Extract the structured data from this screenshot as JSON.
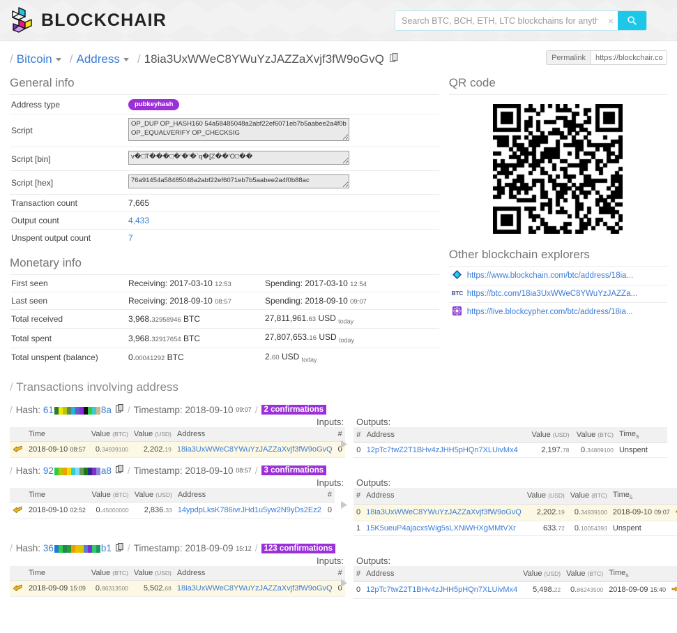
{
  "brand": {
    "name": "BLOCKCHAIR",
    "logo_colors": [
      "#23c3e8",
      "#e6197f",
      "#f5e019",
      "#7b33c9"
    ]
  },
  "search": {
    "placeholder": "Search BTC, BCH, ETH, LTC blockchains for anything...",
    "value": "",
    "clear_label": "×",
    "button_icon": "search-icon",
    "accent": "#1ec7e8"
  },
  "breadcrumb": {
    "sep": "/",
    "chain": "Bitcoin",
    "kind": "Address",
    "address": "18ia3UxWWeC8YWuYzJAZZaXvjf3fW9oGvQ",
    "copy_icon": "copy-icon"
  },
  "permalink": {
    "label": "Permalink",
    "value": "https://blockchair.co"
  },
  "general": {
    "title": "General info",
    "rows": [
      {
        "key": "Address type",
        "badge": "pubkeyhash"
      },
      {
        "key": "Script",
        "value": "OP_DUP OP_HASH160 54a58485048a2abf22ef6071eb7b5aabee2a4f0b OP_EQUALVERIFY OP_CHECKSIG"
      },
      {
        "key": "Script [bin]",
        "value": "v�□T���□�'�'�`q�[Z��'O□��"
      },
      {
        "key": "Script [hex]",
        "value": "76a91454a58485048a2abf22ef6071eb7b5aabee2a4f0b88ac"
      },
      {
        "key": "Transaction count",
        "value": "7,665"
      },
      {
        "key": "Output count",
        "value": "4,433"
      },
      {
        "key": "Unspent output count",
        "value": "7"
      }
    ]
  },
  "monetary": {
    "title": "Monetary info",
    "rows": [
      {
        "key": "First seen",
        "c1_main": "Receiving: 2017-03-10",
        "c1_sub": "12:53",
        "c2_main": "Spending: 2017-03-10",
        "c2_sub": "12:54"
      },
      {
        "key": "Last seen",
        "c1_main": "Receiving: 2018-09-10",
        "c1_sub": "08:57",
        "c2_main": "Spending: 2018-09-10",
        "c2_sub": "09:07"
      },
      {
        "key": "Total received",
        "c1_int": "3,968.",
        "c1_dec": "32958946",
        "c1_unit": "BTC",
        "c2_int": "27,811,961.",
        "c2_dec": "63",
        "c2_unit": "USD",
        "c2_when": "today"
      },
      {
        "key": "Total spent",
        "c1_int": "3,968.",
        "c1_dec": "32917654",
        "c1_unit": "BTC",
        "c2_int": "27,807,653.",
        "c2_dec": "16",
        "c2_unit": "USD",
        "c2_when": "today"
      },
      {
        "key": "Total unspent (balance)",
        "c1_int": "0.",
        "c1_dec": "00041292",
        "c1_unit": "BTC",
        "c2_int": "2.",
        "c2_dec": "60",
        "c2_unit": "USD",
        "c2_when": "today"
      }
    ]
  },
  "qr": {
    "title": "QR code"
  },
  "explorers": {
    "title": "Other blockchain explorers",
    "items": [
      {
        "icon": "blockchain-com-favicon",
        "url": "https://www.blockchain.com/btc/address/18ia..."
      },
      {
        "icon": "btc-com-favicon",
        "url": "https://btc.com/18ia3UxWWeC8YWuYzJAZZa..."
      },
      {
        "icon": "blockcypher-favicon",
        "url": "https://live.blockcypher.com/btc/address/18ia..."
      }
    ]
  },
  "tx_section": {
    "title": "Transactions involving address",
    "inputs_label": "Inputs:",
    "outputs_label": "Outputs:"
  },
  "in_headers": {
    "time": "Time",
    "value_btc": "Value",
    "value_btc_u": "(BTC)",
    "value_usd": "Value",
    "value_usd_u": "(USD)",
    "address": "Address",
    "num": "#"
  },
  "out_headers": {
    "num": "#",
    "address": "Address",
    "value_usd": "Value",
    "value_usd_u": "(USD)",
    "value_btc": "Value",
    "value_btc_u": "(BTC)",
    "time": "Time",
    "time_sub": "s"
  },
  "transactions": [
    {
      "hash_prefix": "61",
      "hash_suffix": "8a",
      "identicon": [
        "#2b7d2b",
        "#f0e800",
        "#b8c800",
        "#5a8a5a",
        "#1fb5d8",
        "#6a5acd",
        "#8a2be2",
        "#121212",
        "#2ecc40",
        "#39cccc",
        "#c8b88a"
      ],
      "timestamp_date": "2018-09-10",
      "timestamp_time": "09:07",
      "confirmations": "2 confirmations",
      "inputs": [
        {
          "icon": "wallet-icon",
          "date": "2018-09-10",
          "time": "08:57",
          "btc_int": "0.",
          "btc_dec": "34939100",
          "usd_int": "2,202.",
          "usd_dec": "19",
          "address": "18ia3UxWWeC8YWuYzJAZZaXvjf3fW9oGvQ",
          "num": "0",
          "highlight": true
        }
      ],
      "outputs": [
        {
          "num": "0",
          "address": "12pTc7twZ2T1BHv4zJHH5pHQn7XLUivMx4",
          "usd_int": "2,197.",
          "usd_dec": "78",
          "btc_int": "0.",
          "btc_dec": "34869100",
          "time": "Unspent",
          "time_sub": "",
          "spent_icon": false,
          "highlight": false
        }
      ]
    },
    {
      "hash_prefix": "92",
      "hash_suffix": "a8",
      "identicon": [
        "#2ecc40",
        "#b8c800",
        "#f0a000",
        "#e8e000",
        "#39cccc",
        "#7fdbff",
        "#6a9a5a",
        "#1a7a1a",
        "#2b2b8a",
        "#7b33c9",
        "#8a8ad8"
      ],
      "timestamp_date": "2018-09-10",
      "timestamp_time": "08:57",
      "confirmations": "3 confirmations",
      "inputs": [
        {
          "icon": "wallet-icon",
          "date": "2018-09-10",
          "time": "02:52",
          "btc_int": "0.",
          "btc_dec": "45000000",
          "usd_int": "2,836.",
          "usd_dec": "33",
          "address": "14ypdpLksK786ivrJHd1u5yw2N9yDs2Ez2",
          "num": "0",
          "highlight": false
        }
      ],
      "outputs": [
        {
          "num": "0",
          "address": "18ia3UxWWeC8YWuYzJAZZaXvjf3fW9oGvQ",
          "usd_int": "2,202.",
          "usd_dec": "19",
          "btc_int": "0.",
          "btc_dec": "34939100",
          "time": "2018-09-10",
          "time_sub": "09:07",
          "spent_icon": true,
          "highlight": true
        },
        {
          "num": "1",
          "address": "15K5ueuP4ajacxsWig5sLXNiWHXgMMtVXr",
          "usd_int": "633.",
          "usd_dec": "72",
          "btc_int": "0.",
          "btc_dec": "10054393",
          "time": "Unspent",
          "time_sub": "",
          "spent_icon": false,
          "highlight": false
        }
      ]
    },
    {
      "hash_prefix": "36",
      "hash_suffix": "b1",
      "identicon": [
        "#1f7ad8",
        "#2ecc40",
        "#1a8a4a",
        "#2a9a3a",
        "#e8a000",
        "#f0c000",
        "#d8c800",
        "#5a7ad8",
        "#7b33c9",
        "#2ecc70",
        "#1a9a5a"
      ],
      "timestamp_date": "2018-09-09",
      "timestamp_time": "15:12",
      "confirmations": "123 confirmations",
      "inputs": [
        {
          "icon": "wallet-icon",
          "date": "2018-09-09",
          "time": "15:09",
          "btc_int": "0.",
          "btc_dec": "86313500",
          "usd_int": "5,502.",
          "usd_dec": "68",
          "address": "18ia3UxWWeC8YWuYzJAZZaXvjf3fW9oGvQ",
          "num": "0",
          "highlight": true
        }
      ],
      "outputs": [
        {
          "num": "0",
          "address": "12pTc7twZ2T1BHv4zJHH5pHQn7XLUivMx4",
          "usd_int": "5,498.",
          "usd_dec": "22",
          "btc_int": "0.",
          "btc_dec": "86243500",
          "time": "2018-09-09",
          "time_sub": "15:40",
          "spent_icon": true,
          "highlight": false
        }
      ]
    }
  ]
}
